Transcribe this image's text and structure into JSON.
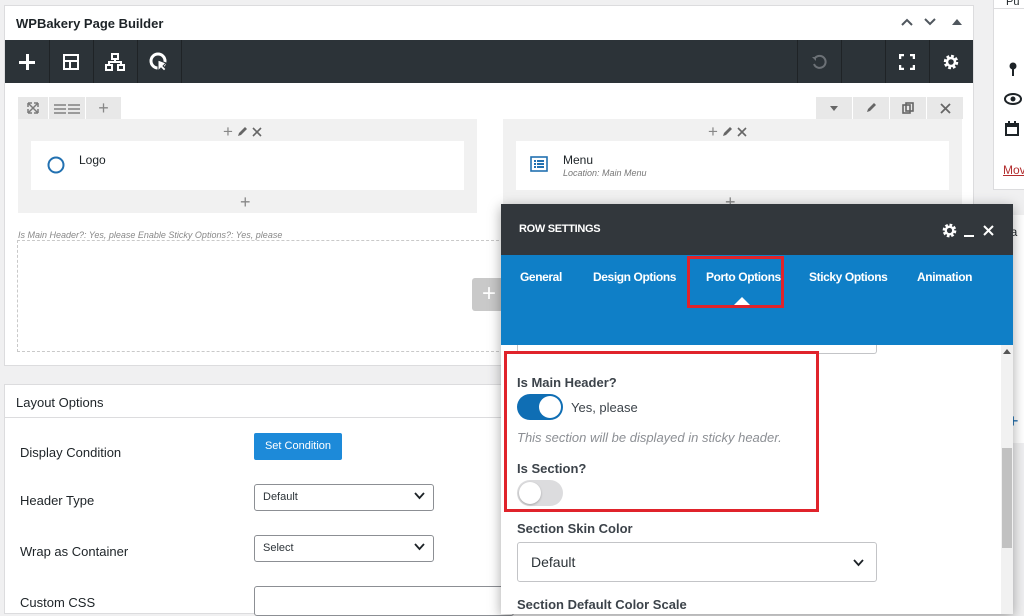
{
  "builder": {
    "title": "WPBakery Page Builder",
    "row_info": "Is Main Header?: Yes, please  Enable Sticky Options?: Yes, please",
    "columns": [
      {
        "element": {
          "name": "Logo",
          "subtitle": ""
        }
      },
      {
        "element": {
          "name": "Menu",
          "subtitle": "Location: Main Menu"
        }
      }
    ]
  },
  "layout_options": {
    "title": "Layout Options",
    "fields": [
      {
        "label": "Display Condition",
        "button": "Set Condition"
      },
      {
        "label": "Header Type",
        "value": "Default"
      },
      {
        "label": "Wrap as Container",
        "value": "Select"
      },
      {
        "label": "Custom CSS"
      }
    ]
  },
  "sidebar": {
    "title_fragment": "Pu",
    "link_fragment": "Mov",
    "heading_fragment": "ea"
  },
  "modal": {
    "title": "ROW SETTINGS",
    "tabs": [
      "General",
      "Design Options",
      "Porto Options",
      "Sticky Options",
      "Animation"
    ],
    "active_tab": "Porto Options",
    "fields": {
      "main_header_label": "Is Main Header?",
      "main_header_value": "Yes, please",
      "main_header_on": true,
      "main_header_hint": "This section will be displayed in sticky header.",
      "section_label": "Is Section?",
      "section_on": false,
      "skin_color_label": "Section Skin Color",
      "skin_color_value": "Default",
      "color_scale_label": "Section Default Color Scale"
    }
  },
  "colors": {
    "accent_blue": "#0f7fc7",
    "toolbar_dark": "#2c3338",
    "highlight_red": "#e0232b",
    "button_blue": "#2271b1"
  }
}
